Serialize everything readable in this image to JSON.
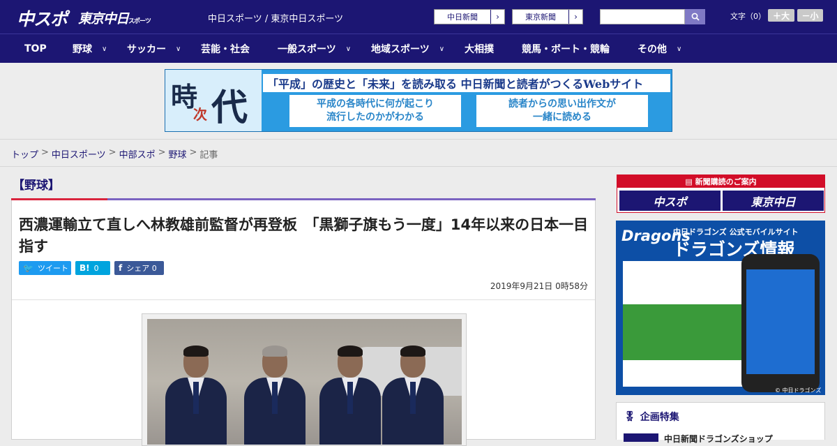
{
  "header": {
    "logo_chuspo": "中スポ",
    "logo_tokyo": "東京中日",
    "logo_tokyo_small": "スポーツ",
    "site_link": "中日スポーツ / 東京中日スポーツ",
    "paper_buttons": [
      "中日新聞",
      "東京新聞"
    ],
    "search_icon": "search-icon",
    "font_size_label": "文字（0）",
    "size_larger": "＋大",
    "size_smaller": "－小"
  },
  "nav": {
    "items": [
      "TOP",
      "野球",
      "サッカー",
      "芸能・社会",
      "一般スポーツ",
      "地域スポーツ",
      "大相撲",
      "競馬・ボート・競輪",
      "その他"
    ]
  },
  "banner": {
    "char1": "時",
    "char2": "次",
    "char3": "代",
    "headline": "「平成」の歴史と「未来」を読み取る 中日新聞と読者がつくるWebサイト",
    "box1_line1": "平成の各時代に何が起こり",
    "box1_line2": "流行したのかがわかる",
    "box2_line1": "読者からの思い出作文が",
    "box2_line2": "一緒に読める"
  },
  "breadcrumb": {
    "items": [
      "トップ",
      "中日スポーツ",
      "中部スポ",
      "野球"
    ],
    "current": "記事",
    "separator": ">"
  },
  "category": "【野球】",
  "article": {
    "title": "西濃運輸立て直しへ林教雄前監督が再登板　「黒獅子旗もう一度」14年以来の日本一目指す",
    "share": {
      "tweet_label": "ツイート",
      "hatena_label": "B!",
      "hatena_count": "0",
      "facebook_label": "シェア",
      "facebook_count": "0"
    },
    "date": "2019年9月21日 0時58分"
  },
  "sidebar": {
    "subscribe_head": "新聞購読のご案内",
    "subscribe_logos": [
      "中スポ",
      "東京中日"
    ],
    "dragons_logo": "Dragons",
    "dragons_sub": "中日ドラゴンズ 公式モバイルサイト",
    "dragons_main": "ドラゴンズ情報",
    "dragons_credit": "© 中日ドラゴンズ",
    "kikaku_title": "企画特集",
    "kikaku_item": "中日新聞ドラゴンズショップ"
  },
  "colors": {
    "brand_navy": "#1c1673",
    "accent_red": "#d9243d",
    "accent_purple": "#7b63c1",
    "twitter": "#1d9bf0",
    "hatena": "#00a4de",
    "facebook": "#3b5998"
  }
}
